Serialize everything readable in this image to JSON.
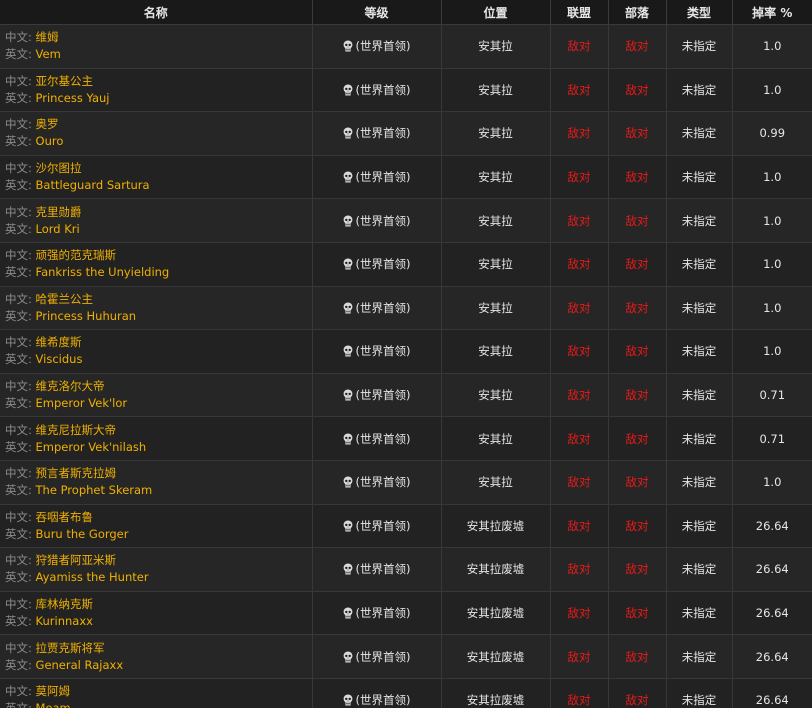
{
  "headers": {
    "name": "名称",
    "level": "等级",
    "location": "位置",
    "alliance": "联盟",
    "horde": "部落",
    "type": "类型",
    "drop_rate": "掉率 %"
  },
  "labels": {
    "zh": "中文: ",
    "en": "英文: "
  },
  "icons": {
    "boss": "skull-icon"
  },
  "colors": {
    "boss_name": "#f0b000",
    "hostile": "#e81a1a",
    "label": "#8a8a8a"
  },
  "rows": [
    {
      "zh": "维姆",
      "en": "Vem",
      "level": "(世界首领)",
      "location": "安其拉",
      "alliance": "敌对",
      "horde": "敌对",
      "type": "未指定",
      "drop": "1.0"
    },
    {
      "zh": "亚尔基公主",
      "en": "Princess Yauj",
      "level": "(世界首领)",
      "location": "安其拉",
      "alliance": "敌对",
      "horde": "敌对",
      "type": "未指定",
      "drop": "1.0"
    },
    {
      "zh": "奥罗",
      "en": "Ouro",
      "level": "(世界首领)",
      "location": "安其拉",
      "alliance": "敌对",
      "horde": "敌对",
      "type": "未指定",
      "drop": "0.99"
    },
    {
      "zh": "沙尔图拉",
      "en": "Battleguard Sartura",
      "level": "(世界首领)",
      "location": "安其拉",
      "alliance": "敌对",
      "horde": "敌对",
      "type": "未指定",
      "drop": "1.0"
    },
    {
      "zh": "克里勋爵",
      "en": "Lord Kri",
      "level": "(世界首领)",
      "location": "安其拉",
      "alliance": "敌对",
      "horde": "敌对",
      "type": "未指定",
      "drop": "1.0"
    },
    {
      "zh": "顽强的范克瑞斯",
      "en": "Fankriss the Unyielding",
      "level": "(世界首领)",
      "location": "安其拉",
      "alliance": "敌对",
      "horde": "敌对",
      "type": "未指定",
      "drop": "1.0"
    },
    {
      "zh": "哈霍兰公主",
      "en": "Princess Huhuran",
      "level": "(世界首领)",
      "location": "安其拉",
      "alliance": "敌对",
      "horde": "敌对",
      "type": "未指定",
      "drop": "1.0"
    },
    {
      "zh": "维希度斯",
      "en": "Viscidus",
      "level": "(世界首领)",
      "location": "安其拉",
      "alliance": "敌对",
      "horde": "敌对",
      "type": "未指定",
      "drop": "1.0"
    },
    {
      "zh": "维克洛尔大帝",
      "en": "Emperor Vek'lor",
      "level": "(世界首领)",
      "location": "安其拉",
      "alliance": "敌对",
      "horde": "敌对",
      "type": "未指定",
      "drop": "0.71"
    },
    {
      "zh": "维克尼拉斯大帝",
      "en": "Emperor Vek'nilash",
      "level": "(世界首领)",
      "location": "安其拉",
      "alliance": "敌对",
      "horde": "敌对",
      "type": "未指定",
      "drop": "0.71"
    },
    {
      "zh": "预言者斯克拉姆",
      "en": "The Prophet Skeram",
      "level": "(世界首领)",
      "location": "安其拉",
      "alliance": "敌对",
      "horde": "敌对",
      "type": "未指定",
      "drop": "1.0"
    },
    {
      "zh": "吞咽者布鲁",
      "en": "Buru the Gorger",
      "level": "(世界首领)",
      "location": "安其拉废墟",
      "alliance": "敌对",
      "horde": "敌对",
      "type": "未指定",
      "drop": "26.64"
    },
    {
      "zh": "狩猎者阿亚米斯",
      "en": "Ayamiss the Hunter",
      "level": "(世界首领)",
      "location": "安其拉废墟",
      "alliance": "敌对",
      "horde": "敌对",
      "type": "未指定",
      "drop": "26.64"
    },
    {
      "zh": "库林纳克斯",
      "en": "Kurinnaxx",
      "level": "(世界首领)",
      "location": "安其拉废墟",
      "alliance": "敌对",
      "horde": "敌对",
      "type": "未指定",
      "drop": "26.64"
    },
    {
      "zh": "拉贾克斯将军",
      "en": "General Rajaxx",
      "level": "(世界首领)",
      "location": "安其拉废墟",
      "alliance": "敌对",
      "horde": "敌对",
      "type": "未指定",
      "drop": "26.64"
    },
    {
      "zh": "莫阿姆",
      "en": "Moam",
      "level": "(世界首领)",
      "location": "安其拉废墟",
      "alliance": "敌对",
      "horde": "敌对",
      "type": "未指定",
      "drop": "26.64"
    }
  ]
}
